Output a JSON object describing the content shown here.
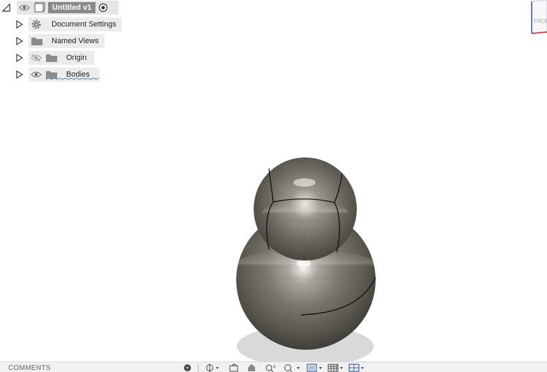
{
  "browser": {
    "root": {
      "title": "Untitled v1"
    },
    "items": [
      {
        "label": "Document Settings",
        "icon": "gear-icon"
      },
      {
        "label": "Named Views",
        "icon": "folder-icon"
      },
      {
        "label": "Origin",
        "icon": "folder-icon",
        "visibility": "hidden"
      },
      {
        "label": "Bodies",
        "icon": "folder-icon",
        "visibility": "visible"
      }
    ]
  },
  "viewcube": {
    "faces": [
      "FRONT"
    ]
  },
  "bottom": {
    "comments_label": "COMMENTS",
    "comments_add": "+",
    "tools": [
      "orbit-icon",
      "look-at-icon",
      "pan-icon",
      "zoom-icon",
      "fit-icon",
      "display-settings-icon",
      "grid-icon",
      "viewports-icon"
    ]
  },
  "colors": {
    "model": "#7b7770",
    "ground_shadow": "#d9d9d9",
    "edge": "#111111",
    "panel": "#ececec"
  }
}
